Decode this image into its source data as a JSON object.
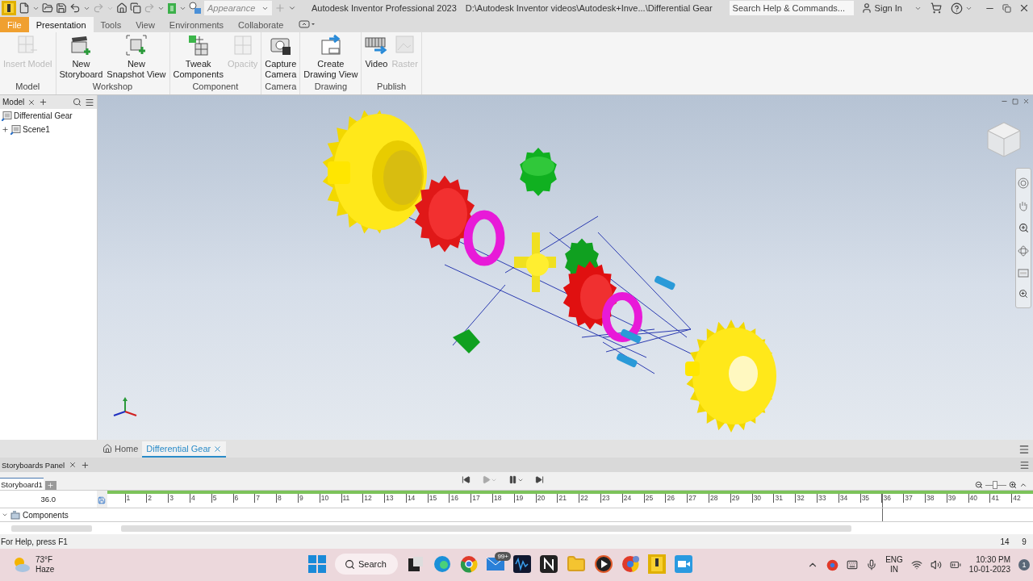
{
  "title_bar": {
    "appearance": "Appearance",
    "app_title": "Autodesk Inventor Professional 2023",
    "file_path": "D:\\Autodesk Inventor videos\\Autodesk+Inve...\\Differential Gear",
    "search_placeholder": "Search Help & Commands...",
    "sign_in": "Sign In"
  },
  "ribbon_tabs": [
    {
      "label": "File",
      "kind": "file",
      "selected": false
    },
    {
      "label": "Presentation",
      "kind": "tab",
      "selected": true
    },
    {
      "label": "Tools",
      "kind": "tab",
      "selected": false
    },
    {
      "label": "View",
      "kind": "tab",
      "selected": false
    },
    {
      "label": "Environments",
      "kind": "tab",
      "selected": false
    },
    {
      "label": "Collaborate",
      "kind": "tab",
      "selected": false
    }
  ],
  "ribbon_groups": [
    {
      "label": "Model",
      "buttons": [
        {
          "label": "Insert Model",
          "kind": "insert",
          "disabled": true
        }
      ]
    },
    {
      "label": "Workshop",
      "buttons": [
        {
          "label": "New Storyboard",
          "kind": "storyboard",
          "disabled": false
        },
        {
          "label": "New Snapshot View",
          "kind": "snapshot",
          "disabled": false
        }
      ]
    },
    {
      "label": "Component",
      "buttons": [
        {
          "label": "Tweak Components",
          "kind": "tweak",
          "disabled": false
        },
        {
          "label": "Opacity",
          "kind": "opacity",
          "disabled": true
        }
      ]
    },
    {
      "label": "Camera",
      "buttons": [
        {
          "label": "Capture Camera",
          "kind": "camera",
          "disabled": false
        }
      ]
    },
    {
      "label": "Drawing",
      "buttons": [
        {
          "label": "Create Drawing View",
          "kind": "drawing",
          "disabled": false
        }
      ]
    },
    {
      "label": "Publish",
      "buttons": [
        {
          "label": "Video",
          "kind": "video",
          "disabled": false
        },
        {
          "label": "Raster",
          "kind": "raster",
          "disabled": true
        }
      ]
    }
  ],
  "model_browser": {
    "tab": "Model",
    "tree": [
      {
        "label": "Differential Gear"
      },
      {
        "label": "Scene1",
        "expanded": false
      }
    ]
  },
  "document_tabs": [
    {
      "label": "Home",
      "kind": "home",
      "selected": false
    },
    {
      "label": "Differential Gear",
      "kind": "document",
      "selected": true
    }
  ],
  "storyboards_panel": {
    "title": "Storyboards Panel",
    "storyboard_tabs": [
      {
        "label": "Storyboard1",
        "selected": true
      }
    ],
    "current_time": "36.0",
    "ticks": [
      "1",
      "2",
      "3",
      "4",
      "5",
      "6",
      "7",
      "8",
      "9",
      "10",
      "11",
      "12",
      "13",
      "14",
      "15",
      "16",
      "17",
      "18",
      "19",
      "20",
      "21",
      "22",
      "23",
      "24",
      "25",
      "26",
      "27",
      "28",
      "29",
      "30",
      "31",
      "32",
      "33",
      "34",
      "35",
      "36",
      "37",
      "38",
      "39",
      "40",
      "41",
      "42"
    ],
    "playhead": {
      "level": 0.837
    },
    "zoom": {
      "level": 0.5
    },
    "tracks": [
      {
        "label": "Components",
        "expanded": true
      }
    ]
  },
  "status_bar": {
    "help": "For Help, press F1",
    "values": [
      "14",
      "9"
    ]
  },
  "taskbar": {
    "temperature": "73°F",
    "weather": "Haze",
    "search": "Search",
    "mail_badge": "99+",
    "language": "ENG",
    "region": "IN",
    "time": "10:30 PM",
    "date": "10-01-2023",
    "notifications": "1"
  }
}
